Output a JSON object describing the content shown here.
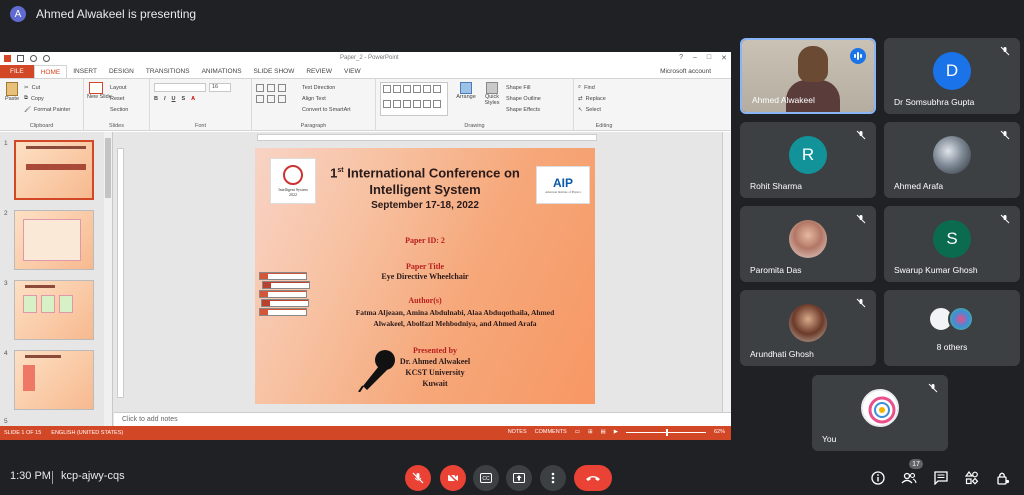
{
  "meeting": {
    "presenter_initial": "A",
    "presenting_text": "Ahmed Alwakeel is presenting",
    "time": "1:30 PM",
    "code": "kcp-ajwy-cqs",
    "participant_count": "17"
  },
  "powerpoint": {
    "window_title": "Paper_2 - PowerPoint",
    "tabs": [
      "FILE",
      "HOME",
      "INSERT",
      "DESIGN",
      "TRANSITIONS",
      "ANIMATIONS",
      "SLIDE SHOW",
      "REVIEW",
      "VIEW"
    ],
    "account": "Microsoft account",
    "ribbon": {
      "clipboard": {
        "paste": "Paste",
        "cut": "Cut",
        "copy": "Copy",
        "format_painter": "Format Painter",
        "label": "Clipboard"
      },
      "slides": {
        "new_slide": "New Slide",
        "layout": "Layout",
        "reset": "Reset",
        "section": "Section",
        "label": "Slides"
      },
      "font": {
        "size": "16",
        "label": "Font"
      },
      "paragraph": {
        "text_direction": "Text Direction",
        "align_text": "Align Text",
        "smartart": "Convert to SmartArt",
        "label": "Paragraph"
      },
      "drawing": {
        "arrange": "Arrange",
        "quick_styles": "Quick Styles",
        "shape_fill": "Shape Fill",
        "shape_outline": "Shape Outline",
        "shape_effects": "Shape Effects",
        "label": "Drawing"
      },
      "editing": {
        "find": "Find",
        "replace": "Replace",
        "select": "Select",
        "label": "Editing"
      }
    },
    "thumbnails": [
      {
        "num": "1"
      },
      {
        "num": "2"
      },
      {
        "num": "3"
      },
      {
        "num": "4"
      },
      {
        "num": "5"
      }
    ],
    "slide": {
      "logo_left_text": "Intelligent System",
      "logo_left_year": "2022",
      "title_sup": "st",
      "title_num": "1",
      "title_rest": "International Conference on",
      "title_line2": "Intelligent System",
      "date": "September 17-18, 2022",
      "aip_logo": "AIP",
      "aip_sub": "American Institute of Physics",
      "paper_id": "Paper ID: 2",
      "paper_title_label": "Paper Title",
      "paper_title": "Eye Directive Wheelchair",
      "authors_label": "Author(s)",
      "authors_line1": "Fatma Aljeaan, Amina Abdulnabi, Alaa Abduqothaila, Ahmed",
      "authors_line2": "Alwakeel, Abolfazl Mehbodniya, and Ahmed Arafa",
      "presented_by_label": "Presented by",
      "presenter": "Dr. Ahmed Alwakeel",
      "university": "KCST University",
      "country": "Kuwait"
    },
    "notes_placeholder": "Click to add notes",
    "status": {
      "slide_of": "SLIDE 1 OF 15",
      "language": "ENGLISH (UNITED STATES)",
      "notes": "NOTES",
      "comments": "COMMENTS",
      "zoom": "62%"
    }
  },
  "participants": [
    {
      "name": "Ahmed Alwakeel",
      "type": "video",
      "speaking": true
    },
    {
      "name": "Dr Somsubhra Gupta",
      "initial": "D",
      "color": "#1a73e8"
    },
    {
      "name": "Rohit Sharma",
      "initial": "R",
      "color": "#12939a"
    },
    {
      "name": "Ahmed Arafa",
      "type": "photo"
    },
    {
      "name": "Paromita Das",
      "type": "photo"
    },
    {
      "name": "Swarup Kumar Ghosh",
      "initial": "S",
      "color": "#0b6b4f"
    },
    {
      "name": "Arundhati Ghosh",
      "type": "photo"
    },
    {
      "name": "8 others",
      "type": "group"
    },
    {
      "name": "You",
      "type": "self"
    }
  ]
}
